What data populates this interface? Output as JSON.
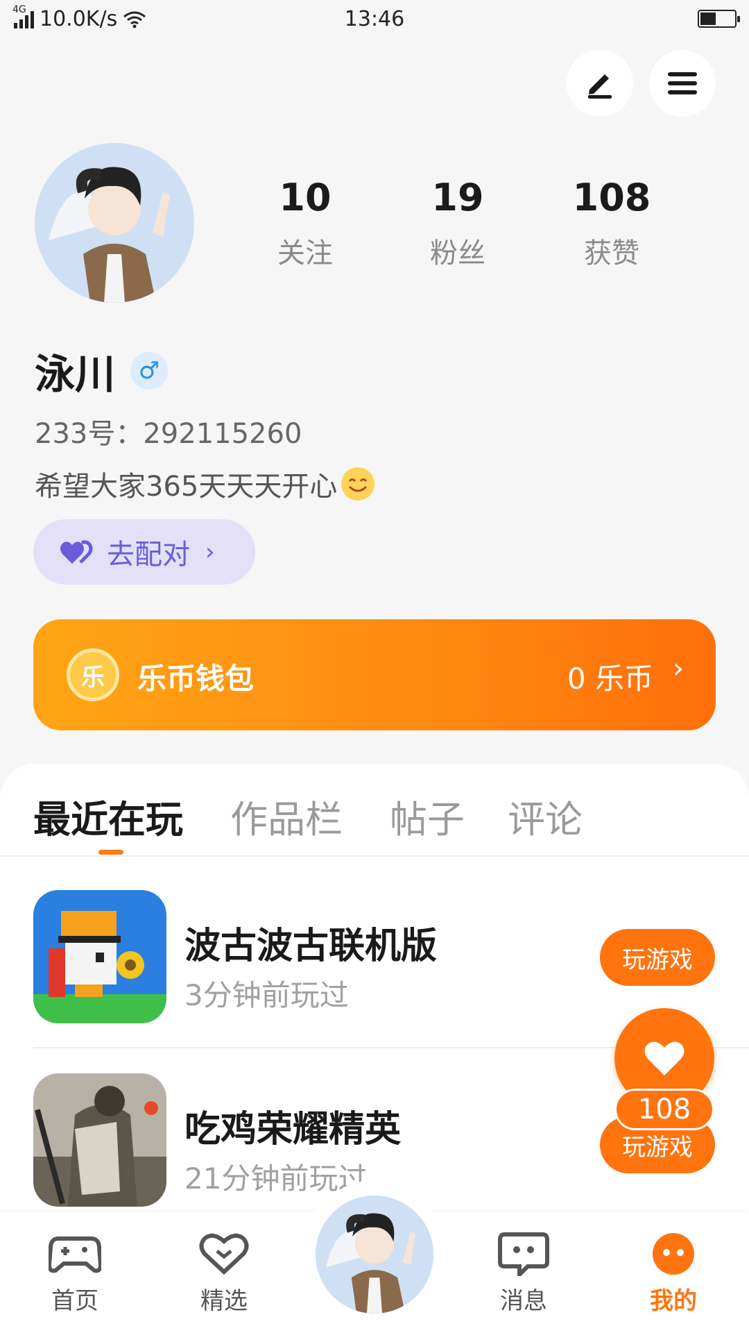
{
  "status_bar": {
    "network": "4G",
    "speed": "10.0K/s",
    "time": "13:46"
  },
  "profile": {
    "name": "泳川",
    "gender_symbol": "♂",
    "id_line": "233号：292115260",
    "bio": "希望大家365天天天开心",
    "stats": [
      {
        "value": "10",
        "label": "关注"
      },
      {
        "value": "19",
        "label": "粉丝"
      },
      {
        "value": "108",
        "label": "获赞"
      }
    ],
    "pair_button": "去配对",
    "chevron": "›"
  },
  "wallet": {
    "coin_char": "乐",
    "title": "乐币钱包",
    "balance": "0 乐币",
    "chevron": "›"
  },
  "tabs": [
    "最近在玩",
    "作品栏",
    "帖子",
    "评论"
  ],
  "games": [
    {
      "name": "波古波古联机版",
      "time": "3分钟前玩过",
      "button": "玩游戏"
    },
    {
      "name": "吃鸡荣耀精英",
      "time": "21分钟前玩过",
      "button": "玩游戏"
    }
  ],
  "like_fab": {
    "count": "108"
  },
  "bottom_nav": [
    {
      "label": "首页",
      "icon": "gamepad-icon"
    },
    {
      "label": "精选",
      "icon": "heart-outline-icon"
    },
    {
      "label": "消息",
      "icon": "chat-bubble-icon"
    },
    {
      "label": "我的",
      "icon": "smile-face-icon"
    }
  ],
  "colors": {
    "accent": "#ff740f",
    "pair_purple": "#6a5cd9",
    "gender_blue": "#2a8de6"
  }
}
